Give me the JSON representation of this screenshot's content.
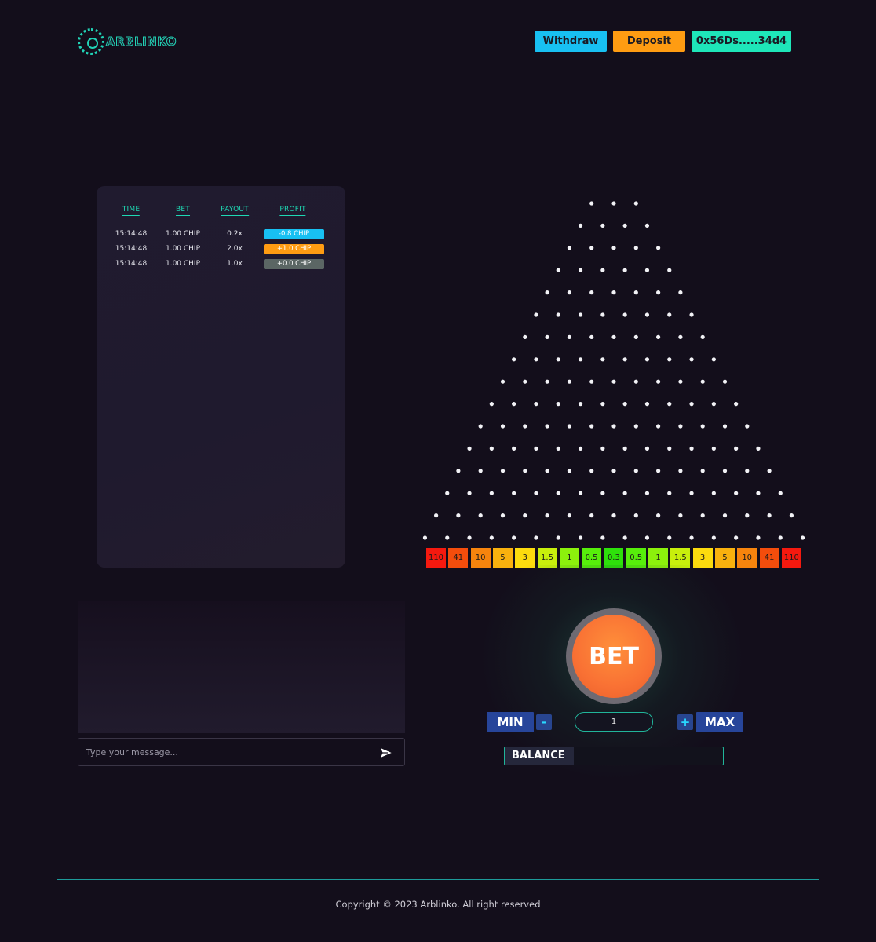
{
  "header": {
    "logo_text": "ARBLINKO",
    "withdraw_label": "Withdraw",
    "deposit_label": "Deposit",
    "wallet_label": "0x56Ds.....34d4"
  },
  "history": {
    "columns": [
      "TIME",
      "BET",
      "PAYOUT",
      "PROFIT"
    ],
    "rows": [
      {
        "time": "15:14:48",
        "bet": "1.00 CHIP",
        "payout": "0.2x",
        "profit": "-0.8 CHIP",
        "color": "#18c0f2"
      },
      {
        "time": "15:14:48",
        "bet": "1.00 CHIP",
        "payout": "2.0x",
        "profit": "+1.0 CHIP",
        "color": "#ff9c12"
      },
      {
        "time": "15:14:48",
        "bet": "1.00 CHIP",
        "payout": "1.0x",
        "profit": "+0.0 CHIP",
        "color": "#5b6664"
      }
    ]
  },
  "chat": {
    "placeholder": "Type your message..."
  },
  "board": {
    "rows": 16,
    "multipliers": [
      "110",
      "41",
      "10",
      "5",
      "3",
      "1.5",
      "1",
      "0.5",
      "0.3",
      "0.5",
      "1",
      "1.5",
      "3",
      "5",
      "10",
      "41",
      "110"
    ],
    "multiplier_colors": [
      "#f5190f",
      "#f44d0c",
      "#f7840d",
      "#f9b10e",
      "#fcdb0e",
      "#c8ef0c",
      "#8cf10c",
      "#57ee0b",
      "#2ee10b",
      "#57ee0b",
      "#8cf10c",
      "#c8ef0c",
      "#fcdb0e",
      "#f9b10e",
      "#f7840d",
      "#f44d0c",
      "#f5190f"
    ]
  },
  "controls": {
    "bet_label": "BET",
    "min_label": "MIN",
    "max_label": "MAX",
    "minus_label": "-",
    "plus_label": "+",
    "amount_value": "1",
    "balance_label": "BALANCE",
    "balance_value": ""
  },
  "footer": {
    "copyright": "Copyright © 2023 Arblinko. All right reserved"
  }
}
